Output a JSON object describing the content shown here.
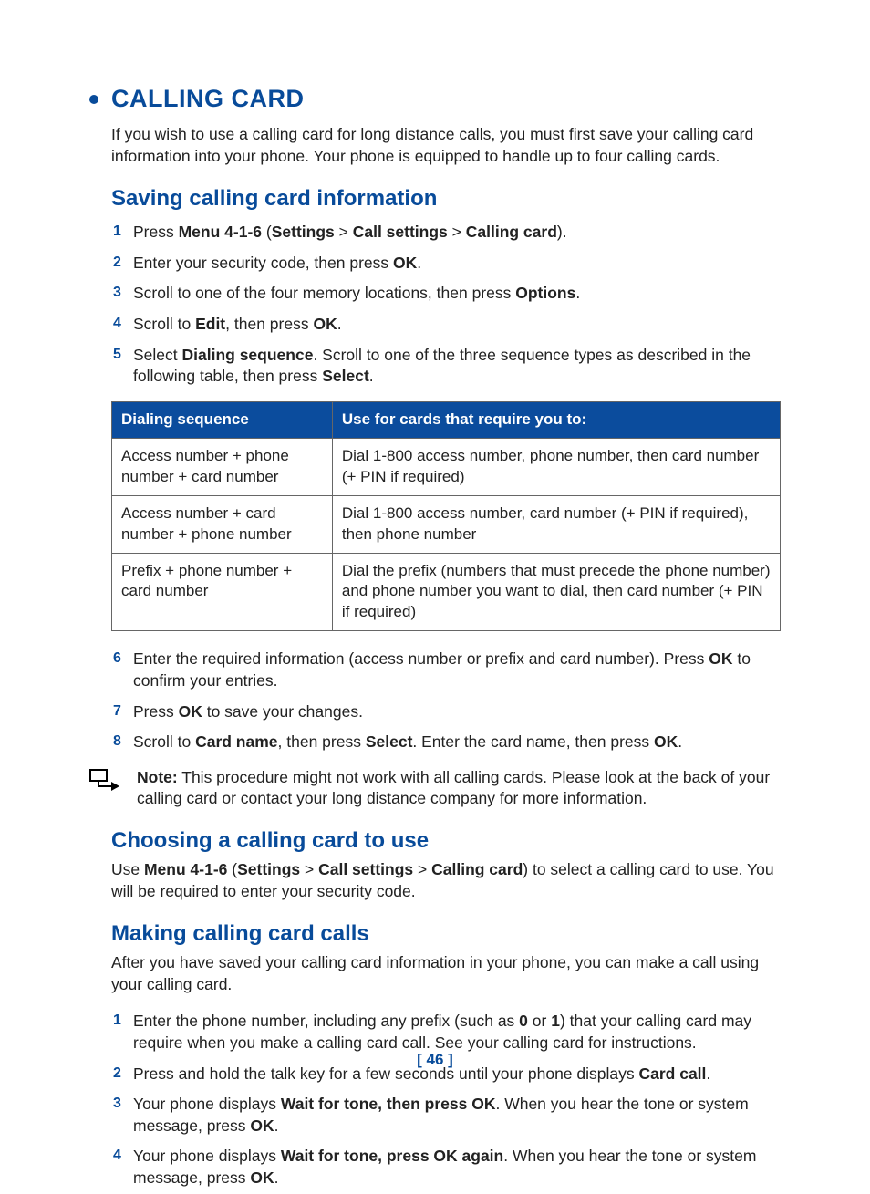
{
  "h1": "CALLING CARD",
  "intro": "If you wish to use a calling card for long distance calls, you must first save your calling card information into your phone. Your phone is equipped to handle up to four calling cards.",
  "sect1": {
    "title": "Saving calling card information",
    "steps_a": [
      {
        "pre": "Press ",
        "b1": "Menu 4-1-6",
        "mid": " (",
        "b2": "Settings",
        "gt1": " > ",
        "b3": "Call settings",
        "gt2": " > ",
        "b4": "Calling card",
        "post": ")."
      },
      {
        "pre": "Enter your security code, then press ",
        "b1": "OK",
        "post": "."
      },
      {
        "pre": "Scroll to one of the four memory locations, then press ",
        "b1": "Options",
        "post": "."
      },
      {
        "pre": "Scroll to ",
        "b1": "Edit",
        "mid": ", then press ",
        "b2": "OK",
        "post": "."
      },
      {
        "pre": "Select ",
        "b1": "Dialing sequence",
        "mid": ". Scroll to one of the three sequence types as described in the following table, then press ",
        "b2": "Select",
        "post": "."
      }
    ],
    "table": {
      "h1": "Dialing sequence",
      "h2": "Use for cards that require you to:",
      "rows": [
        {
          "c1": "Access number + phone number + card number",
          "c2": "Dial 1-800 access number, phone number, then card number (+ PIN if required)"
        },
        {
          "c1": "Access number + card number + phone number",
          "c2": "Dial 1-800 access number, card number (+ PIN if required), then phone number"
        },
        {
          "c1": "Prefix + phone number + card number",
          "c2": "Dial the prefix (numbers that must precede the phone number) and phone number you want to dial, then card number (+ PIN if required)"
        }
      ]
    },
    "steps_b": [
      {
        "pre": "Enter the required information (access number or prefix and card number). Press ",
        "b1": "OK",
        "post": " to confirm your entries."
      },
      {
        "pre": "Press ",
        "b1": "OK",
        "post": " to save your changes."
      },
      {
        "pre": "Scroll to ",
        "b1": "Card name",
        "mid": ", then press ",
        "b2": "Select",
        "mid2": ". Enter the card name, then press ",
        "b3": "OK",
        "post": "."
      }
    ],
    "note_label": "Note:",
    "note_text": " This procedure might not work with all calling cards. Please look at the back of your calling card or contact your long distance company for more information."
  },
  "sect2": {
    "title": "Choosing a calling card to use",
    "pre": "Use ",
    "b1": "Menu 4-1-6",
    "mid1": " (",
    "b2": "Settings",
    "gt1": " > ",
    "b3": "Call settings",
    "gt2": " > ",
    "b4": "Calling card",
    "post": ") to select a calling card to use. You will be required to enter your security code."
  },
  "sect3": {
    "title": "Making calling card calls",
    "intro": "After you have saved your calling card information in your phone, you can make a call using your calling card.",
    "steps": [
      {
        "pre": "Enter the phone number, including any prefix (such as ",
        "b1": "0",
        "mid": " or ",
        "b2": "1",
        "post": ") that your calling card may require when you make a calling card call. See your calling card for instructions."
      },
      {
        "pre": "Press and hold the talk key for a few seconds until your phone displays ",
        "b1": "Card call",
        "post": "."
      },
      {
        "pre": "Your phone displays ",
        "b1": "Wait for tone, then press OK",
        "mid": ". When you hear the tone or system message, press ",
        "b2": "OK",
        "post": "."
      },
      {
        "pre": "Your phone displays ",
        "b1": "Wait for tone, press OK again",
        "mid": ". When you hear the tone or system message, press ",
        "b2": "OK",
        "post": "."
      }
    ]
  },
  "page": "[ 46 ]"
}
